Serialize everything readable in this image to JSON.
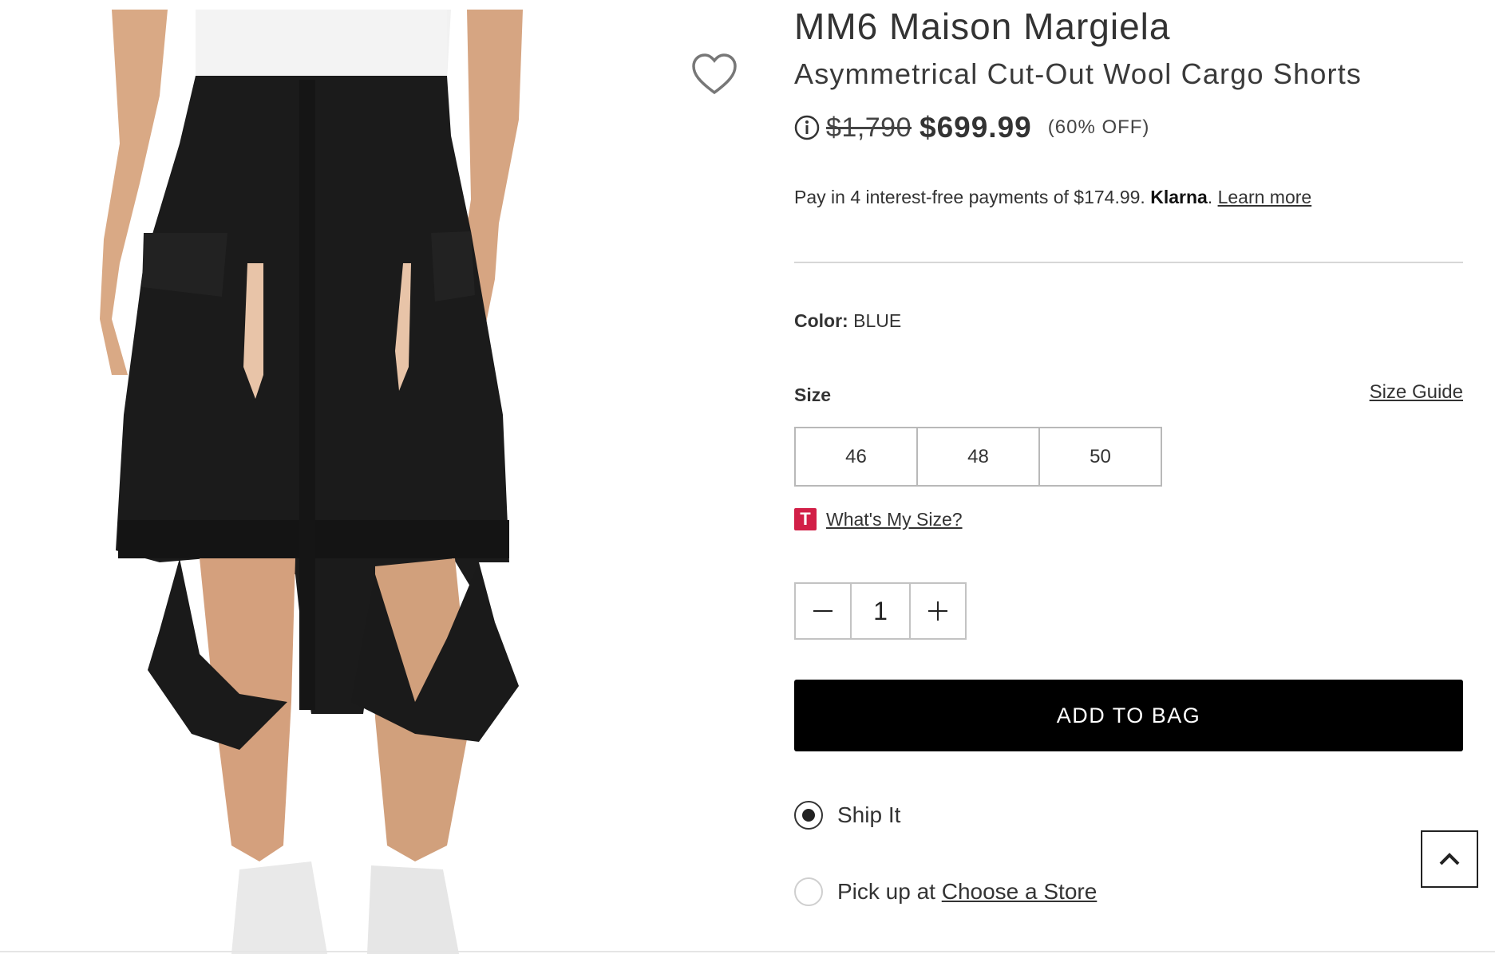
{
  "product": {
    "brand": "MM6 Maison Margiela",
    "name": "Asymmetrical Cut-Out Wool Cargo Shorts",
    "image_alt": "Model wearing black asymmetrical cut-out wool cargo shorts with white sneakers"
  },
  "pricing": {
    "original": "$1,790",
    "sale": "$699.99",
    "discount": "(60% OFF)"
  },
  "klarna": {
    "text": "Pay in 4 interest-free payments of $174.99.",
    "brand": "Klarna",
    "period": ".",
    "link": "Learn more"
  },
  "color": {
    "label": "Color:",
    "value": "BLUE"
  },
  "size": {
    "label": "Size",
    "guide_link": "Size Guide",
    "options": [
      "46",
      "48",
      "50"
    ],
    "fit_icon_letter": "T",
    "fit_link": "What's My Size?"
  },
  "quantity": {
    "value": "1"
  },
  "actions": {
    "add_to_bag": "ADD TO BAG"
  },
  "fulfillment": {
    "ship_label": "Ship It",
    "pickup_prefix": "Pick up at ",
    "pickup_link": "Choose a Store",
    "selected": "ship"
  },
  "colors": {
    "accent_fit": "#d21f47",
    "button_bg": "#000000"
  },
  "icons": {
    "wishlist": "heart-icon",
    "info": "info-icon",
    "minus": "minus-icon",
    "plus": "plus-icon",
    "back_to_top": "chevron-up-icon"
  }
}
